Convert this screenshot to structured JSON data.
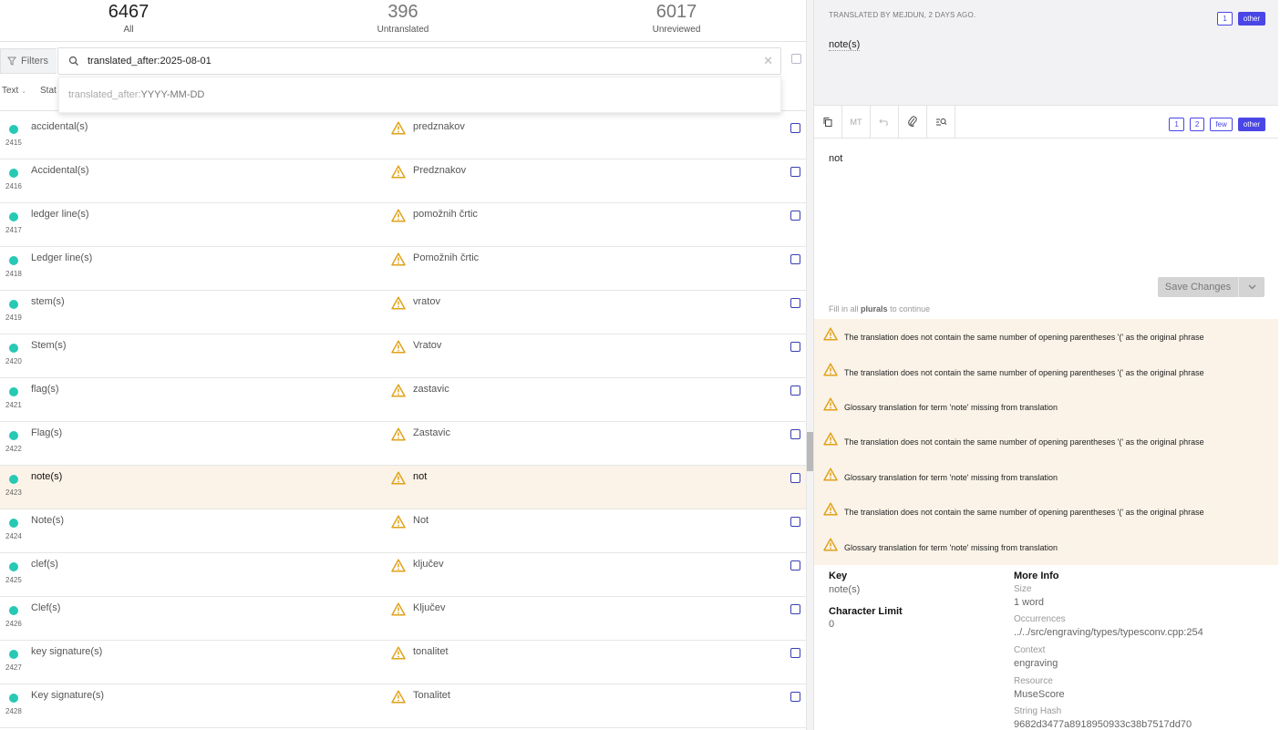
{
  "stats": {
    "all": {
      "num": "6467",
      "label": "All"
    },
    "untranslated": {
      "num": "396",
      "label": "Untranslated"
    },
    "unreviewed": {
      "num": "6017",
      "label": "Unreviewed"
    }
  },
  "filters": {
    "label": "Filters"
  },
  "search": {
    "value": "translated_after:2025-08-01"
  },
  "suggestion": {
    "prefix": "translated_after:",
    "format": "YYYY-MM-DD"
  },
  "columns": {
    "text": "Text",
    "status": "Stat"
  },
  "rows": [
    {
      "src": "accidental(s)",
      "num": "2415",
      "tr": "predznakov"
    },
    {
      "src": "Accidental(s)",
      "num": "2416",
      "tr": "Predznakov"
    },
    {
      "src": "ledger line(s)",
      "num": "2417",
      "tr": "pomožnih črtic"
    },
    {
      "src": "Ledger line(s)",
      "num": "2418",
      "tr": "Pomožnih črtic"
    },
    {
      "src": "stem(s)",
      "num": "2419",
      "tr": "vratov"
    },
    {
      "src": "Stem(s)",
      "num": "2420",
      "tr": "Vratov"
    },
    {
      "src": "flag(s)",
      "num": "2421",
      "tr": "zastavic"
    },
    {
      "src": "Flag(s)",
      "num": "2422",
      "tr": "Zastavic"
    },
    {
      "src": "note(s)",
      "num": "2423",
      "tr": "not"
    },
    {
      "src": "Note(s)",
      "num": "2424",
      "tr": "Not"
    },
    {
      "src": "clef(s)",
      "num": "2425",
      "tr": "ključev"
    },
    {
      "src": "Clef(s)",
      "num": "2426",
      "tr": "Ključev"
    },
    {
      "src": "key signature(s)",
      "num": "2427",
      "tr": "tonalitet"
    },
    {
      "src": "Key signature(s)",
      "num": "2428",
      "tr": "Tonalitet"
    }
  ],
  "active_row_index": 8,
  "source_panel": {
    "meta": "Translated by mejdun, 2 days ago.",
    "text": "note(s)",
    "pills": [
      "1",
      "other"
    ]
  },
  "toolbar": {
    "mt_label": "MT",
    "pills": [
      "1",
      "2",
      "few",
      "other"
    ]
  },
  "editor": {
    "value": "not"
  },
  "save": {
    "label": "Save Changes"
  },
  "hint": {
    "pre": "Fill in all",
    "bold": "plurals",
    "post": "to continue"
  },
  "warnings": [
    "The translation does not contain the same number of opening parentheses '(' as the original phrase",
    "The translation does not contain the same number of opening parentheses '(' as the original phrase",
    "Glossary translation for term 'note' missing from translation",
    "The translation does not contain the same number of opening parentheses '(' as the original phrase",
    "Glossary translation for term 'note' missing from translation",
    "The translation does not contain the same number of opening parentheses '(' as the original phrase",
    "Glossary translation for term 'note' missing from translation"
  ],
  "info": {
    "key_label": "Key",
    "key_value": "note(s)",
    "char_limit_label": "Character Limit",
    "char_limit_value": "0",
    "more_info_label": "More Info",
    "size_label": "Size",
    "size_value": "1 word",
    "occurrences_label": "Occurrences",
    "occurrences_value": "../../src/engraving/types/typesconv.cpp:254",
    "context_label": "Context",
    "context_value": "engraving",
    "resource_label": "Resource",
    "resource_value": "MuseScore",
    "hash_label": "String Hash",
    "hash_value": "9682d3477a8918950933c38b7517dd70"
  },
  "colors": {
    "accent": "#4a46e6",
    "dot": "#27c9b4",
    "warn": "#e0a21a",
    "active_bg": "#fbf3e8"
  }
}
